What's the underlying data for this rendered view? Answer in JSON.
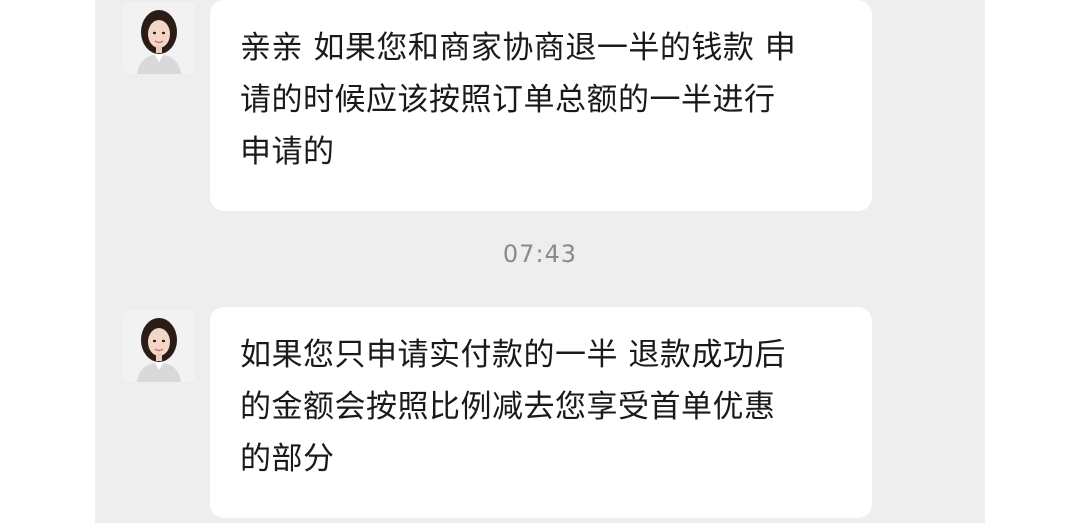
{
  "chat": {
    "messages": [
      {
        "sender": "agent",
        "avatar_icon": "customer-service-avatar-icon",
        "lines": [
          "亲亲 如果您和商家协商退一半的钱款 申",
          "请的时候应该按照订单总额的一半进行",
          "申请的"
        ]
      },
      {
        "sender": "agent",
        "avatar_icon": "customer-service-avatar-icon",
        "lines": [
          "如果您只申请实付款的一半 退款成功后",
          "的金额会按照比例减去您享受首单优惠",
          "的部分"
        ]
      }
    ],
    "timestamp": "07:43"
  }
}
